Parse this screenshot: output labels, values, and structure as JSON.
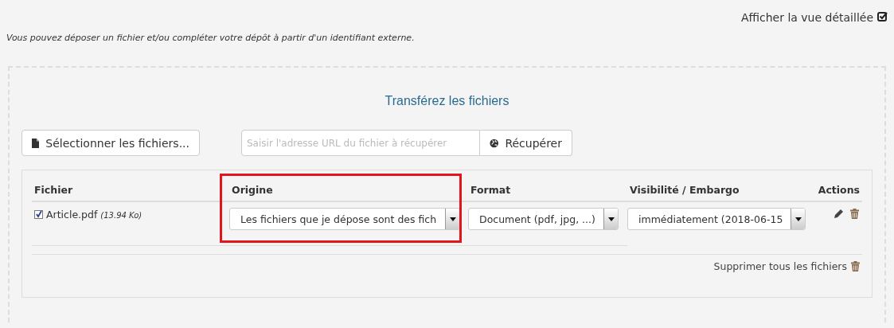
{
  "header": {
    "detail_view_link": "Afficher la vue détaillée",
    "detail_view_checked": true,
    "intro": "Vous pouvez déposer un fichier et/ou compléter votre dépôt à partir d'un identifiant externe."
  },
  "upload": {
    "title": "Transférez les fichiers",
    "select_button": "Sélectionner les fichiers...",
    "url_placeholder": "Saisir l'adresse URL du fichier à récupérer",
    "fetch_button": "Récupérer"
  },
  "table": {
    "columns": [
      "Fichier",
      "Origine",
      "Format",
      "Visibilité / Embargo",
      "Actions"
    ],
    "rows": [
      {
        "checked": true,
        "name": "Article.pdf",
        "size": "(13.94 Ko)",
        "origin": "Les fichiers que je dépose sont des fich",
        "format": "Document (pdf, jpg, ...)",
        "visibility": "immédiatement (2018-06-15"
      }
    ],
    "delete_all": "Supprimer tous les fichiers"
  }
}
